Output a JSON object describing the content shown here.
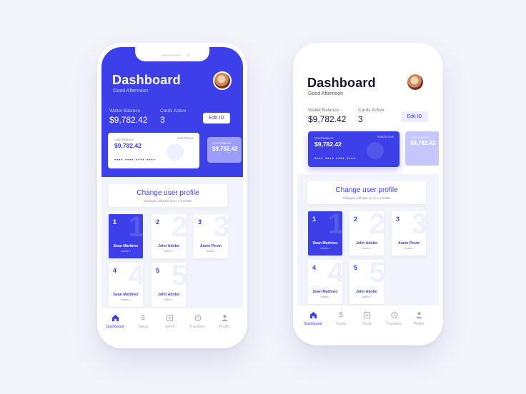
{
  "colors": {
    "accent": "#3d3fe8",
    "accent_light": "#9b9dfb",
    "bg": "#f4f5fb"
  },
  "screen": {
    "title": "Dashboard",
    "greeting": "Good Afternoon",
    "wallet_label": "Wallet Balance",
    "wallet_value": "$9,782.42",
    "cards_label": "Cards Active",
    "cards_value": "3",
    "edit_button": "Edit ID"
  },
  "card_main": {
    "balance_label": "Card balance",
    "balance": "$9,782.42",
    "brand": "matchmove",
    "number_mask": "•••• •••• •••• ••••"
  },
  "card_peek": {
    "balance_label": "Card balance",
    "balance": "$9,782.42"
  },
  "change_profile": {
    "title": "Change user profile",
    "subtitle": "Changes will take up to 5 minutes"
  },
  "users": [
    {
      "num": "1",
      "name": "Sean Martinez",
      "role": "Admin •"
    },
    {
      "num": "2",
      "name": "John Adobo",
      "role": "Editor •"
    },
    {
      "num": "3",
      "name": "Annie Pesto",
      "role": "Guest •"
    },
    {
      "num": "4",
      "name": "Sean Martinez",
      "role": "Admin •"
    },
    {
      "num": "5",
      "name": "John Adobo",
      "role": "Editor •"
    }
  ],
  "nav": [
    {
      "label": "Dashboard",
      "icon": "home-icon"
    },
    {
      "label": "Topup",
      "icon": "dollar-icon"
    },
    {
      "label": "Send",
      "icon": "send-icon"
    },
    {
      "label": "Transfers",
      "icon": "history-icon"
    },
    {
      "label": "Profile",
      "icon": "user-icon"
    }
  ]
}
